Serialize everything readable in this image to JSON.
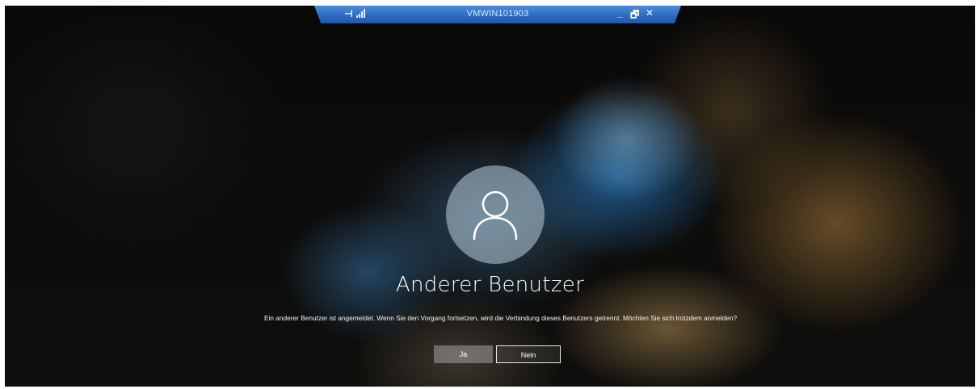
{
  "rdp_bar": {
    "title": "VMWIN101903",
    "pin_icon": "pin-icon",
    "signal_icon": "connection-signal-icon",
    "minimize_glyph": "_",
    "restore_glyph": "🗗",
    "close_glyph": "✕",
    "color": "#2d6cc0"
  },
  "login": {
    "avatar_icon": "user-avatar-icon",
    "user_name": "Anderer Benutzer",
    "message": "Ein anderer Benutzer ist angemeldet. Wenn Sie den Vorgang fortsetzen, wird die Verbindung dieses Benutzers getrennt. Möchten Sie sich trotzdem anmelden?",
    "buttons": {
      "yes": "Ja",
      "no": "Nein"
    }
  }
}
